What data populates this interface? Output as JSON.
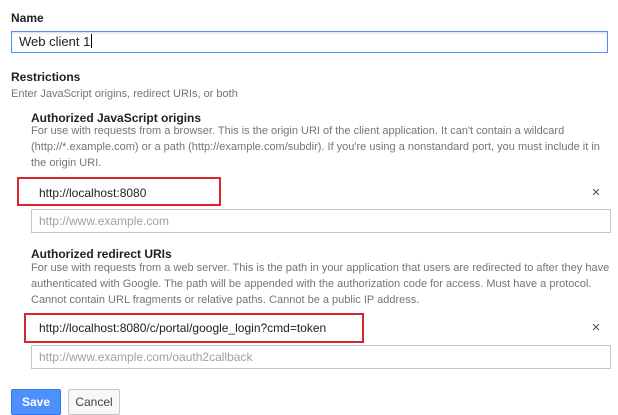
{
  "name_section": {
    "label": "Name",
    "value": "Web client 1"
  },
  "restrictions": {
    "title": "Restrictions",
    "hint": "Enter JavaScript origins, redirect URIs, or both"
  },
  "js_origins": {
    "title": "Authorized JavaScript origins",
    "hint_lines": [
      "For use with requests from a browser. This is the origin URI of the client application. It can't contain a wildcard",
      "(http://*.example.com) or a path (http://example.com/subdir). If you're using a nonstandard port, you must include it in",
      "the origin URI."
    ],
    "entry": "http://localhost:8080",
    "placeholder": "http://www.example.com"
  },
  "redirect_uris": {
    "title": "Authorized redirect URIs",
    "hint_lines": [
      "For use with requests from a web server. This is the path in your application that users are redirected to after they have",
      "authenticated with Google. The path will be appended with the authorization code for access. Must have a protocol.",
      "Cannot contain URL fragments or relative paths. Cannot be a public IP address."
    ],
    "entry": "http://localhost:8080/c/portal/google_login?cmd=token",
    "placeholder": "http://www.example.com/oauth2callback"
  },
  "buttons": {
    "save": "Save",
    "cancel": "Cancel"
  },
  "icons": {
    "remove": "×"
  },
  "colors": {
    "primary": "#4d90fe",
    "highlight": "#d9272e"
  }
}
